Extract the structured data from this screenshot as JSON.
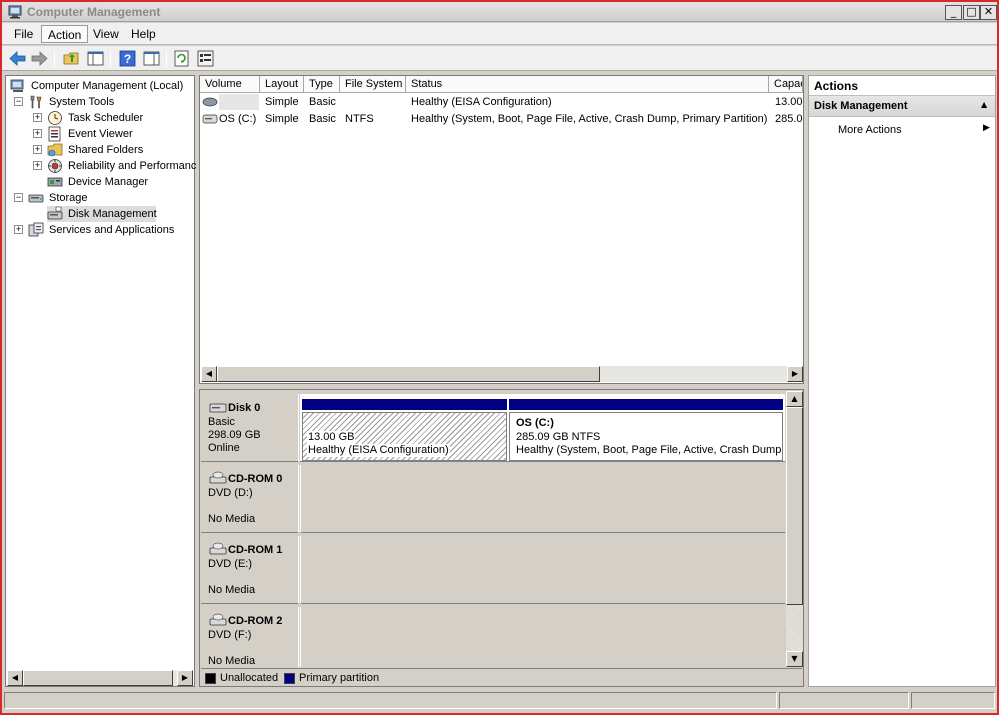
{
  "window": {
    "title": "Computer Management"
  },
  "menu": {
    "items": [
      "File",
      "Action",
      "View",
      "Help"
    ]
  },
  "tree": {
    "root": "Computer Management (Local)",
    "system_tools": "System Tools",
    "task_scheduler": "Task Scheduler",
    "event_viewer": "Event Viewer",
    "shared_folders": "Shared Folders",
    "reliability": "Reliability and Performanc",
    "device_manager": "Device Manager",
    "storage": "Storage",
    "disk_management": "Disk Management",
    "services": "Services and Applications"
  },
  "volume_list": {
    "columns": [
      "Volume",
      "Layout",
      "Type",
      "File System",
      "Status",
      "Capac"
    ],
    "rows": [
      {
        "volume": "",
        "layout": "Simple",
        "type": "Basic",
        "fs": "",
        "status": "Healthy (EISA Configuration)",
        "capacity": "13.00"
      },
      {
        "volume": "OS (C:)",
        "layout": "Simple",
        "type": "Basic",
        "fs": "NTFS",
        "status": "Healthy (System, Boot, Page File, Active, Crash Dump, Primary Partition)",
        "capacity": "285.0"
      }
    ]
  },
  "disks": {
    "disk0": {
      "name": "Disk 0",
      "type": "Basic",
      "size": "298.09 GB",
      "state": "Online"
    },
    "cd0": {
      "name": "CD-ROM 0",
      "type": "DVD (D:)",
      "media": "No Media"
    },
    "cd1": {
      "name": "CD-ROM 1",
      "type": "DVD (E:)",
      "media": "No Media"
    },
    "cd2": {
      "name": "CD-ROM 2",
      "type": "DVD (F:)",
      "media": "No Media"
    }
  },
  "partitions": {
    "p1": {
      "size": "13.00 GB",
      "status": "Healthy (EISA Configuration)"
    },
    "p2": {
      "name": "OS  (C:)",
      "size": "285.09 GB NTFS",
      "status": "Healthy (System, Boot, Page File, Active, Crash Dump"
    }
  },
  "legend": {
    "unallocated": "Unallocated",
    "primary": "Primary partition",
    "unallocated_color": "#000000",
    "primary_color": "#000080"
  },
  "actions": {
    "header": "Actions",
    "section": "Disk Management",
    "more": "More Actions"
  }
}
